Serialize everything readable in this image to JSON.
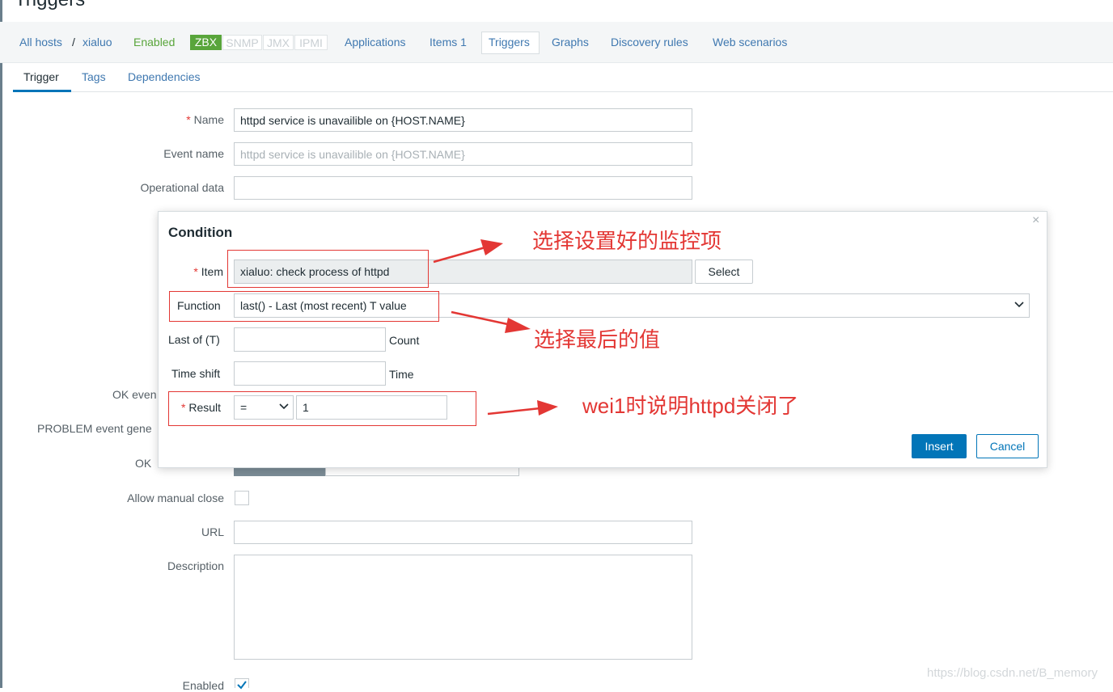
{
  "page": {
    "title": "Triggers"
  },
  "breadcrumb": {
    "all_hosts": "All hosts",
    "separator": "/",
    "host": "xialuo",
    "status": "Enabled",
    "badges": [
      "ZBX",
      "SNMP",
      "JMX",
      "IPMI"
    ],
    "links": {
      "applications": "Applications",
      "items": "Items 1",
      "triggers": "Triggers",
      "graphs": "Graphs",
      "discovery": "Discovery rules",
      "web": "Web scenarios"
    }
  },
  "tabs": [
    "Trigger",
    "Tags",
    "Dependencies"
  ],
  "form": {
    "name_label": "Name",
    "name_value": "httpd service is  unavailible on {HOST.NAME}",
    "event_name_label": "Event name",
    "event_name_placeholder": "httpd service is  unavailible on {HOST.NAME}",
    "operational_label": "Operational data",
    "operational_value": "",
    "ok_event_label_partial": "OK even",
    "problem_label_partial": "PROBLEM event gene",
    "ok_label_partial": "OK",
    "allow_manual_close_label": "Allow manual close",
    "url_label": "URL",
    "url_value": "",
    "description_label": "Description",
    "description_value": "",
    "enabled_label": "Enabled",
    "required_mark": "*"
  },
  "modal": {
    "title": "Condition",
    "close": "×",
    "item_label": "Item",
    "item_value": "xialuo: check process of httpd",
    "select_button": "Select",
    "function_label": "Function",
    "function_value": "last() - Last (most recent) T value",
    "last_of_label": "Last of (T)",
    "last_of_value": "",
    "last_of_unit": "Count",
    "time_shift_label": "Time shift",
    "time_shift_value": "",
    "time_shift_unit": "Time",
    "result_label": "Result",
    "result_operator": "=",
    "result_value": "1",
    "insert_button": "Insert",
    "cancel_button": "Cancel"
  },
  "annotations": {
    "item_note": "选择设置好的监控项",
    "function_note": "选择最后的值",
    "result_note": "wei1时说明httpd关闭了"
  },
  "watermark": "https://blog.csdn.net/B_memory",
  "colors": {
    "accent": "#0275b8",
    "link": "#3f78b0",
    "enabled": "#59a53b",
    "annotation": "#e33734"
  }
}
